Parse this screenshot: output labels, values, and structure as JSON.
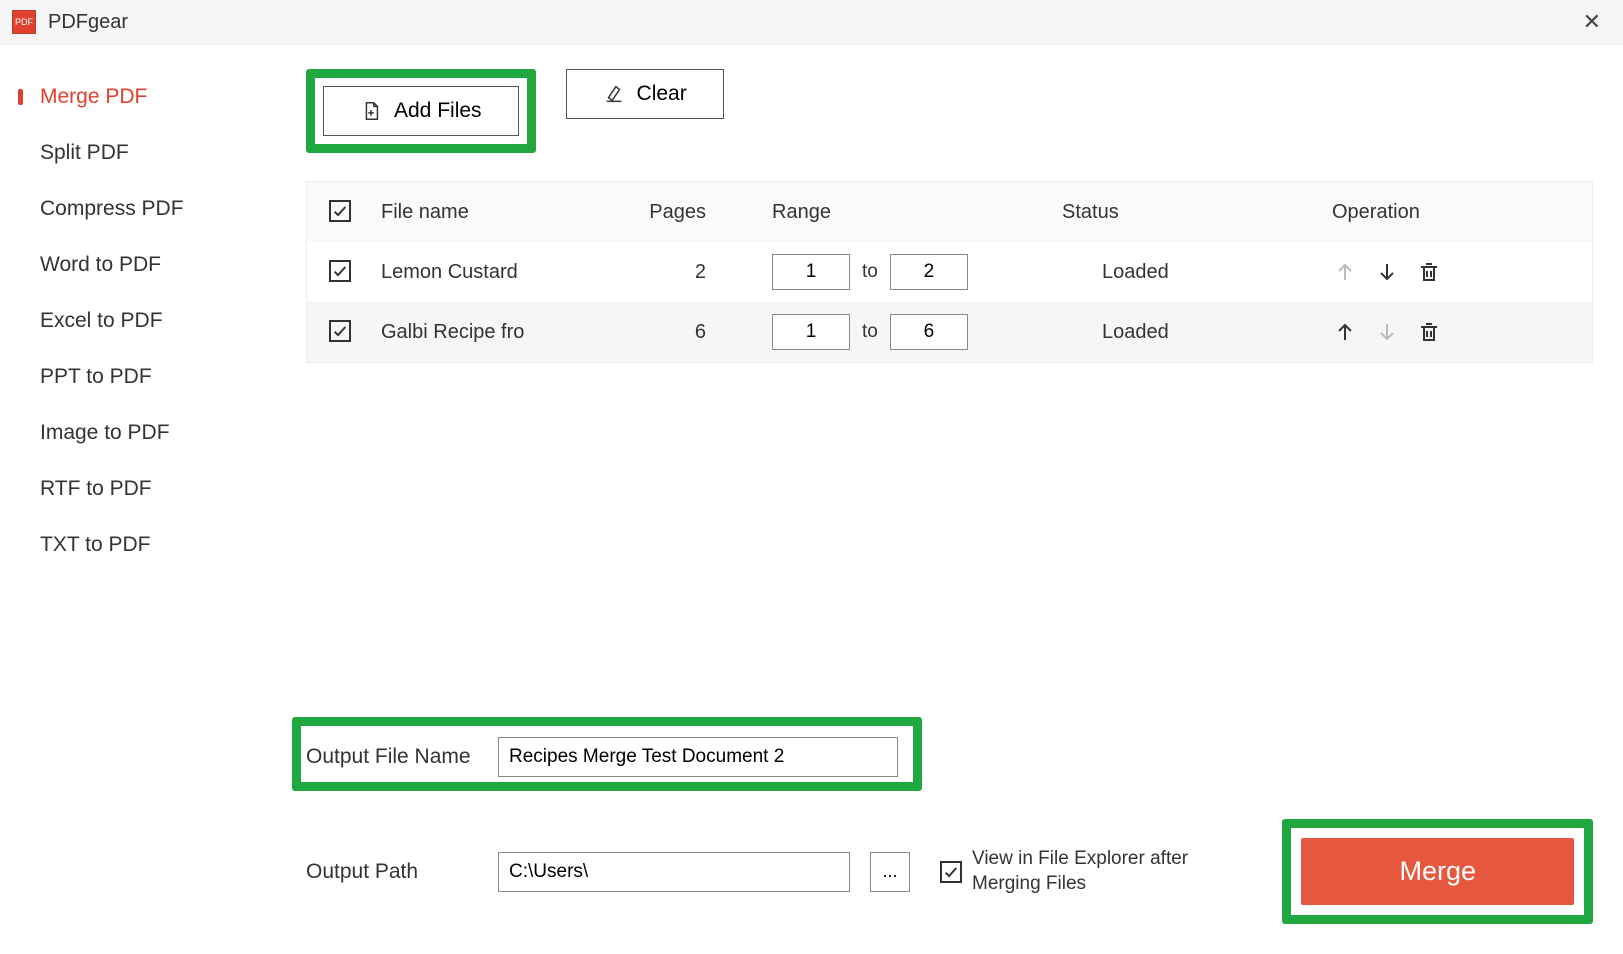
{
  "app": {
    "title": "PDFgear"
  },
  "sidebar": {
    "items": [
      {
        "label": "Merge PDF",
        "active": true
      },
      {
        "label": "Split PDF"
      },
      {
        "label": "Compress PDF"
      },
      {
        "label": "Word to PDF"
      },
      {
        "label": "Excel to PDF"
      },
      {
        "label": "PPT to PDF"
      },
      {
        "label": "Image to PDF"
      },
      {
        "label": "RTF to PDF"
      },
      {
        "label": "TXT to PDF"
      }
    ]
  },
  "toolbar": {
    "add_files": "Add Files",
    "clear": "Clear"
  },
  "table": {
    "headers": {
      "filename": "File name",
      "pages": "Pages",
      "range": "Range",
      "status": "Status",
      "operation": "Operation"
    },
    "range_to": "to",
    "rows": [
      {
        "checked": true,
        "filename": "Lemon Custard",
        "pages": "2",
        "from": "1",
        "to": "2",
        "status": "Loaded",
        "up_enabled": false,
        "down_enabled": true
      },
      {
        "checked": true,
        "filename": "Galbi Recipe fro",
        "pages": "6",
        "from": "1",
        "to": "6",
        "status": "Loaded",
        "up_enabled": true,
        "down_enabled": false
      }
    ]
  },
  "output": {
    "filename_label": "Output File Name",
    "filename_value": "Recipes Merge Test Document 2",
    "path_label": "Output Path",
    "path_value": "C:\\Users\\",
    "browse_label": "...",
    "view_checked": true,
    "view_label": "View in File Explorer after Merging Files",
    "merge_label": "Merge"
  },
  "highlights": {
    "add_files": true,
    "output_filename": true,
    "merge": true
  }
}
